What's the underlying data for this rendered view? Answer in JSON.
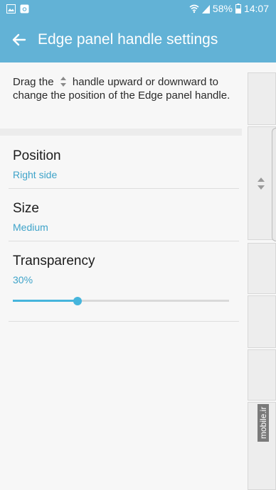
{
  "status_bar": {
    "battery_percent": "58%",
    "time": "14:07",
    "icons": [
      "gallery-icon",
      "instagram-icon",
      "wifi-icon",
      "signal-icon",
      "battery-icon"
    ]
  },
  "app_bar": {
    "back_icon": "back-arrow-icon",
    "title": "Edge panel handle settings"
  },
  "description": {
    "before": "Drag the",
    "icon": "up-down-arrows-icon",
    "after": "handle upward or downward to change the position of the Edge panel handle."
  },
  "settings": [
    {
      "label": "Position",
      "value": "Right side"
    },
    {
      "label": "Size",
      "value": "Medium"
    },
    {
      "label": "Transparency",
      "value": "30%"
    }
  ],
  "transparency_slider": {
    "value_percent": 30
  },
  "watermark": "mobile.ir",
  "colors": {
    "accent": "#62b2d6",
    "value_text": "#3ea3c9",
    "slider": "#46b5dc"
  }
}
